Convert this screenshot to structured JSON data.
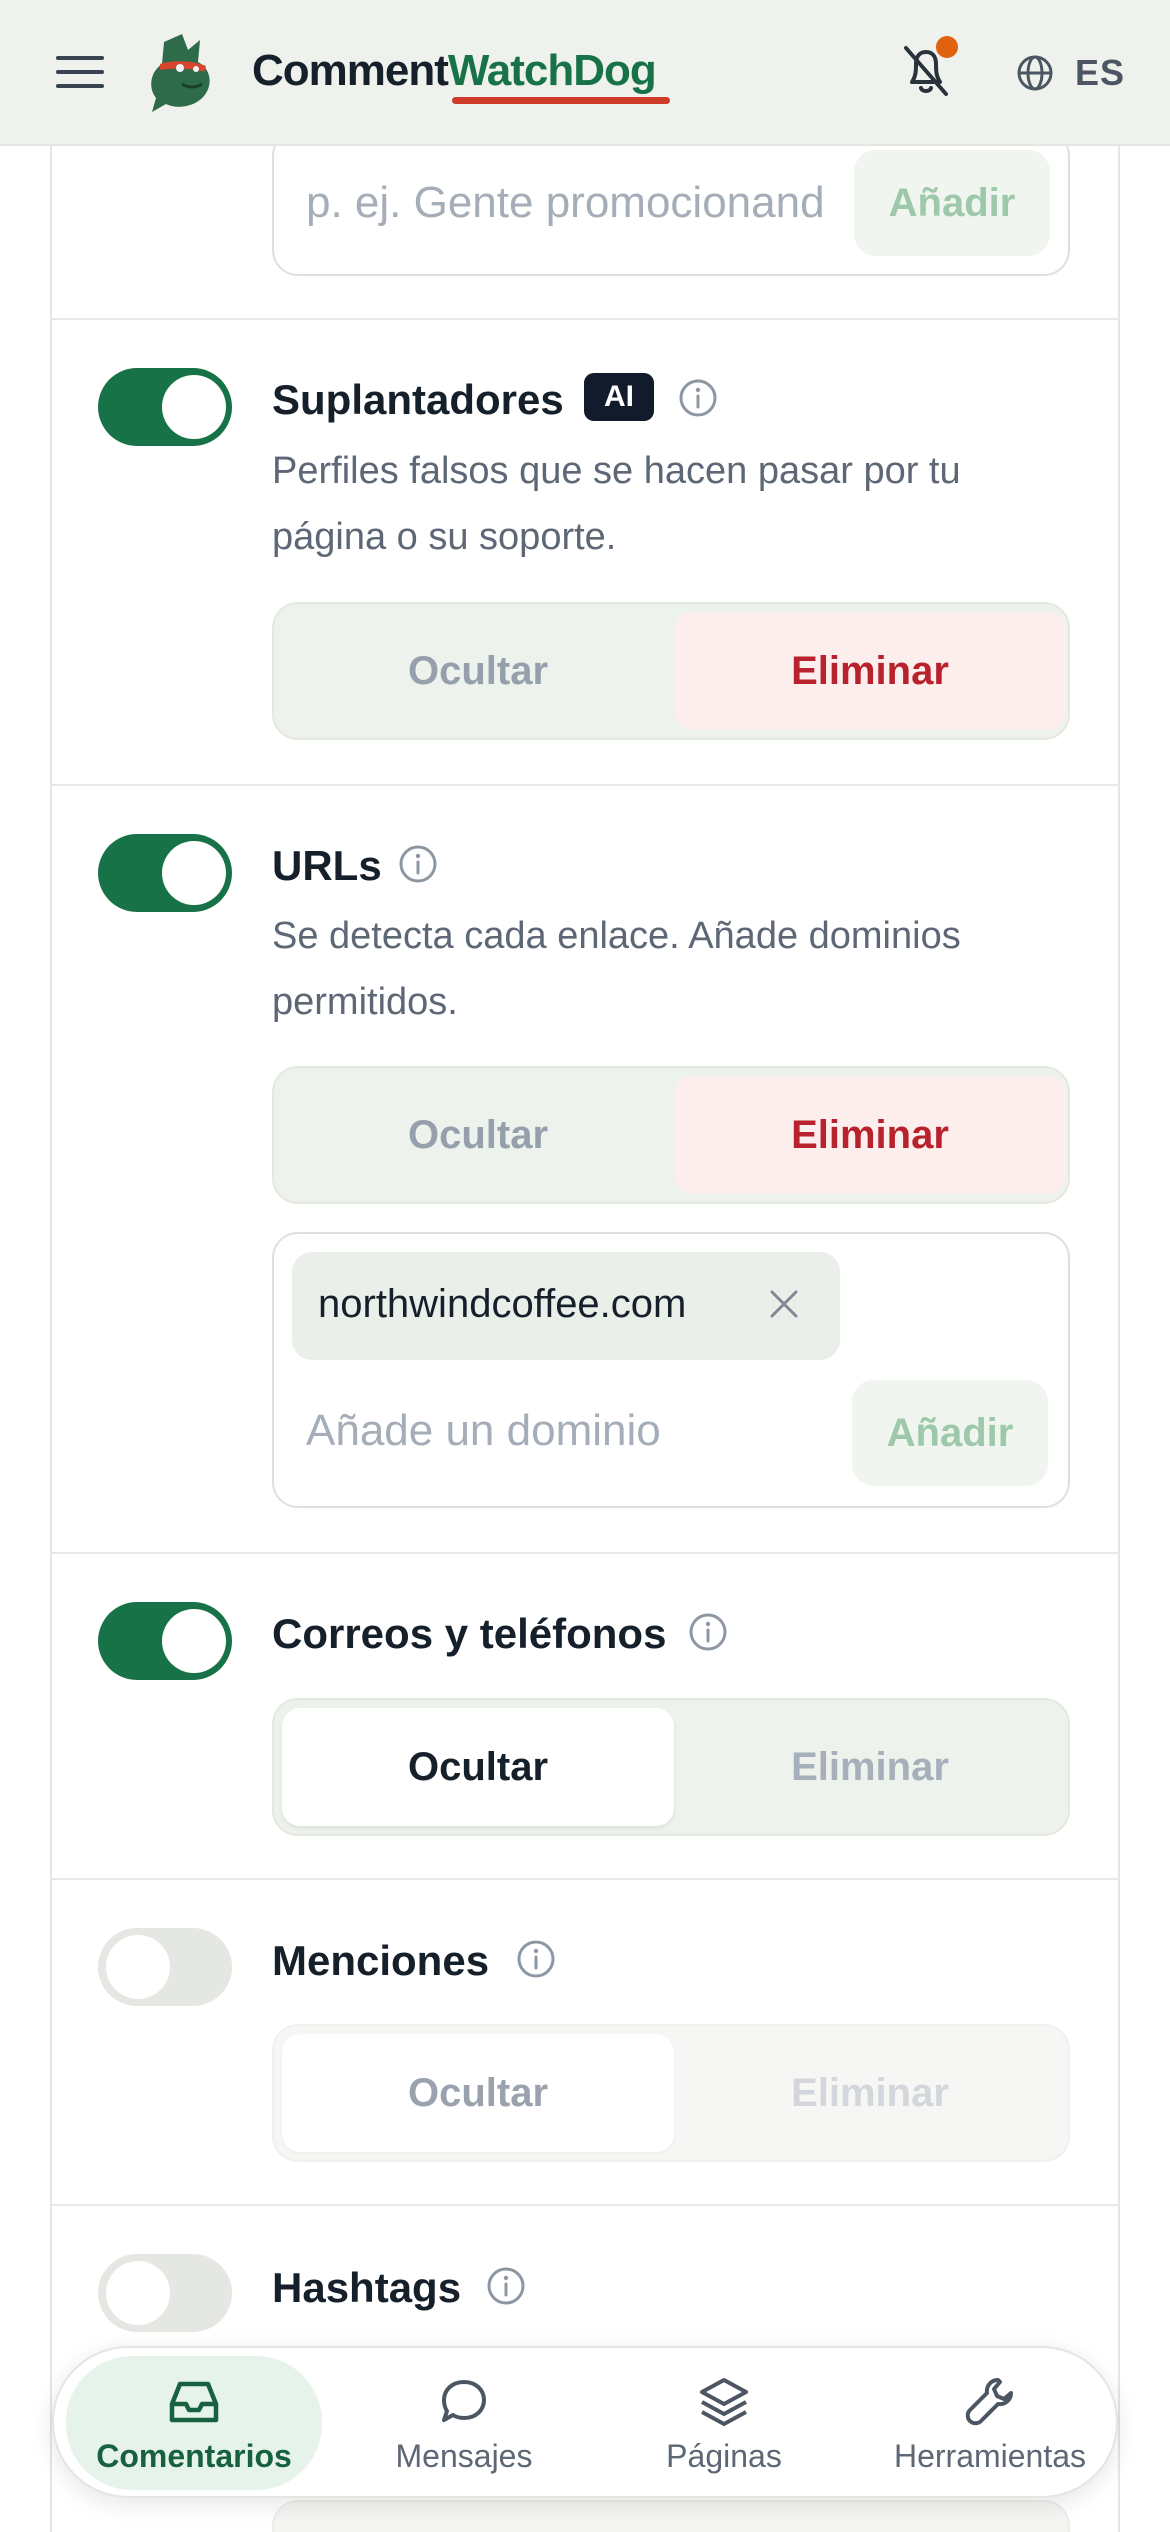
{
  "header": {
    "brand_part1": "Comment",
    "brand_part2": "WatchDog",
    "language": "ES",
    "colors": {
      "brand_green": "#177347",
      "accent_red": "#cf3b2b",
      "notification_dot": "#e0620f"
    }
  },
  "top_input": {
    "placeholder": "p. ej. Gente promocionando",
    "add_label": "Añadir"
  },
  "rules": [
    {
      "title": "Suplantadores",
      "badge": "AI",
      "description": "Perfiles falsos que se hacen pasar por tu página o su soporte.",
      "enabled": true,
      "actions": [
        "Ocultar",
        "Eliminar"
      ],
      "selected_action": "Eliminar"
    },
    {
      "title": "URLs",
      "description": "Se detecta cada enlace. Añade dominios permitidos.",
      "enabled": true,
      "actions": [
        "Ocultar",
        "Eliminar"
      ],
      "selected_action": "Eliminar",
      "allowed_domains": [
        "northwindcoffee.com"
      ],
      "domain_placeholder": "Añade un dominio",
      "add_label": "Añadir"
    },
    {
      "title": "Correos y teléfonos",
      "enabled": true,
      "actions": [
        "Ocultar",
        "Eliminar"
      ],
      "selected_action": "Ocultar"
    },
    {
      "title": "Menciones",
      "enabled": false,
      "actions": [
        "Ocultar",
        "Eliminar"
      ],
      "selected_action": "Ocultar"
    },
    {
      "title": "Hashtags",
      "enabled": false
    }
  ],
  "bottom_nav": {
    "items": [
      {
        "label": "Comentarios",
        "icon": "inbox-icon",
        "active": true
      },
      {
        "label": "Mensajes",
        "icon": "chat-bubble-icon",
        "active": false
      },
      {
        "label": "Páginas",
        "icon": "layers-icon",
        "active": false
      },
      {
        "label": "Herramientas",
        "icon": "wrench-icon",
        "active": false
      }
    ]
  }
}
